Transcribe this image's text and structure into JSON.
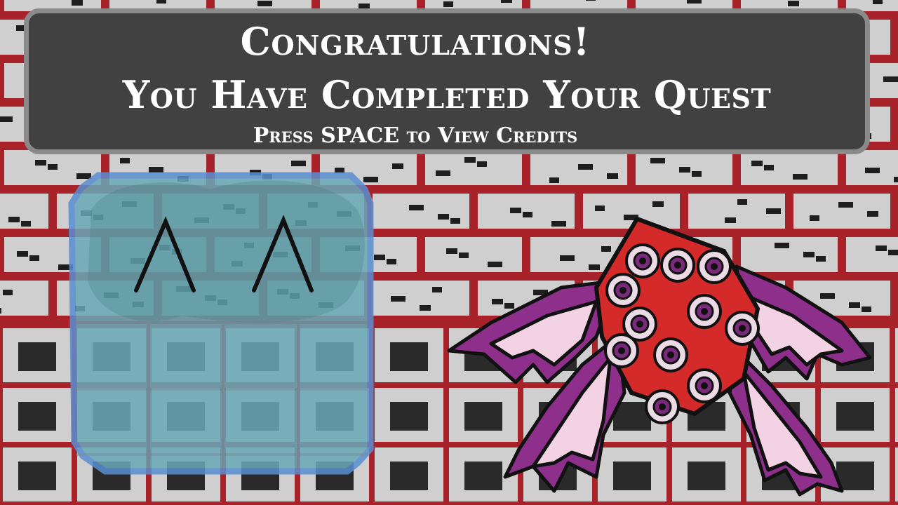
{
  "banner": {
    "title": "Congratulations!",
    "subtitle": "You Have Completed Your Quest",
    "prompt": "Press SPACE to View Credits"
  },
  "colors": {
    "brick_mortar": "#a8222a",
    "brick_face": "#cfcfcf",
    "brick_dark": "#1e1e1e",
    "banner_bg": "#414141",
    "banner_border": "#8a8a8a",
    "hero_body": "#5f9ea8",
    "hero_outline": "#5b8fd1",
    "boss_body": "#d42a2a",
    "boss_wing": "#8e2f8c",
    "boss_wing_membrane": "#f3d3e3",
    "boss_eye_iris": "#7a2a7a"
  },
  "characters": {
    "hero": {
      "icon": "blue-ghost-hero-icon"
    },
    "boss": {
      "icon": "many-eyed-winged-boss-icon"
    }
  }
}
